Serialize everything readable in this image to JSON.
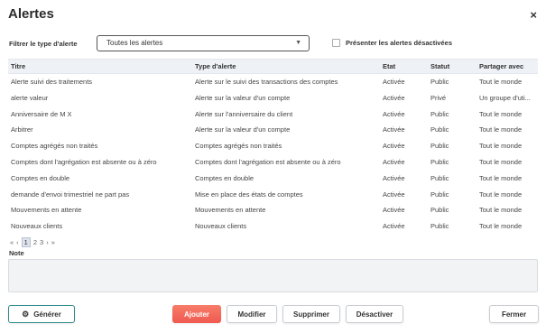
{
  "dialog": {
    "title": "Alertes",
    "close_glyph": "×"
  },
  "filter": {
    "label": "Filtrer le type d'alerte",
    "selected": "Toutes les alertes",
    "show_disabled_label": "Présenter les alertes désactivées",
    "show_disabled_checked": false
  },
  "table": {
    "columns": [
      "Titre",
      "Type d'alerte",
      "Etat",
      "Statut",
      "Partager avec"
    ],
    "sort_column": "Titre",
    "sort_direction": "ascending",
    "rows": [
      {
        "titre": "Alerte suivi des traitements",
        "type": "Alerte sur le suivi des transactions des comptes",
        "etat": "Activée",
        "statut": "Public",
        "partage": "Tout le monde"
      },
      {
        "titre": "alerte valeur",
        "type": "Alerte sur la valeur d'un compte",
        "etat": "Activée",
        "statut": "Privé",
        "partage": "Un groupe d'uti..."
      },
      {
        "titre": "Anniversaire de M X",
        "type": "Alerte sur l'anniversaire du client",
        "etat": "Activée",
        "statut": "Public",
        "partage": "Tout le monde"
      },
      {
        "titre": "Arbitrer",
        "type": "Alerte sur la valeur d'un compte",
        "etat": "Activée",
        "statut": "Public",
        "partage": "Tout le monde"
      },
      {
        "titre": "Comptes agrégés non traités",
        "type": "Comptes agrégés non traités",
        "etat": "Activée",
        "statut": "Public",
        "partage": "Tout le monde"
      },
      {
        "titre": "Comptes dont l'agrégation est absente ou à zéro",
        "type": "Comptes dont l'agrégation est absente ou à zéro",
        "etat": "Activée",
        "statut": "Public",
        "partage": "Tout le monde"
      },
      {
        "titre": "Comptes en double",
        "type": "Comptes en double",
        "etat": "Activée",
        "statut": "Public",
        "partage": "Tout le monde"
      },
      {
        "titre": "demande d'envoi trimestriel ne part pas",
        "type": "Mise en place des états de comptes",
        "etat": "Activée",
        "statut": "Public",
        "partage": "Tout le monde"
      },
      {
        "titre": "Mouvements en attente",
        "type": "Mouvements en attente",
        "etat": "Activée",
        "statut": "Public",
        "partage": "Tout le monde"
      },
      {
        "titre": "Nouveaux clients",
        "type": "Nouveaux clients",
        "etat": "Activée",
        "statut": "Public",
        "partage": "Tout le monde"
      }
    ]
  },
  "pagination": {
    "first": "«",
    "prev": "‹",
    "pages": [
      "1",
      "2",
      "3"
    ],
    "current": "1",
    "next": "›",
    "last": "»"
  },
  "note": {
    "label": "Note",
    "value": ""
  },
  "buttons": {
    "generate": "Générer",
    "add": "Ajouter",
    "modify": "Modifier",
    "delete": "Supprimer",
    "deactivate": "Désactiver",
    "close": "Fermer"
  },
  "icons": {
    "close": "close-icon",
    "dropdown": "chevron-down-icon",
    "sort": "sort-ascending-icon",
    "generate": "gear-icon"
  },
  "colors": {
    "accent_add": "#f3695f",
    "generate_border": "#2d8a8a",
    "header_bg": "#eef1f5"
  }
}
